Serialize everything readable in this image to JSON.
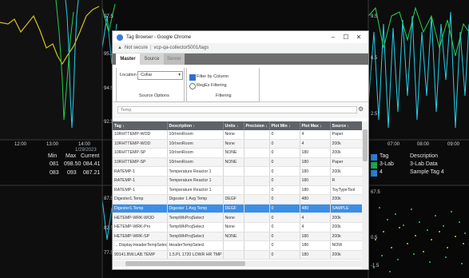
{
  "background": {
    "left_axis_times": [
      "12:00",
      "13:00",
      "14:00"
    ],
    "left_axis_dates": [
      "1/29/2023"
    ],
    "left_table": {
      "headers": [
        "Min",
        "Max",
        "Current"
      ],
      "rows": [
        {
          "min": "081",
          "max": "098.50",
          "current": "084.41"
        },
        {
          "min": "083",
          "max": "093",
          "current": "087.21"
        }
      ]
    },
    "right_axis_times": [
      "07:00",
      "08:00",
      "09:00"
    ],
    "right_table": {
      "headers": [
        "Tag",
        "Description"
      ],
      "rows": [
        {
          "tag": "3-Lab",
          "description": "3-Lab Data"
        },
        {
          "tag": "4",
          "description": "Sample Tag 4"
        }
      ]
    },
    "y_labels": [
      "97.5",
      "95.2",
      "94.5",
      "92.5",
      "90.5",
      "87.5",
      "82.5",
      "77.5",
      "72.5",
      "67.5",
      "62.5",
      "9.5",
      "6.5",
      "2.5",
      "0.5",
      "-1.5"
    ]
  },
  "window": {
    "title": "Tag Browser - Google Chrome",
    "not_secure": "Not secure",
    "url": "vcp-qa-collector5001/tags",
    "controls": {
      "minimize": "–",
      "maximize": "☐",
      "close": "✕"
    },
    "tabs": [
      {
        "label": "Master",
        "active": true
      },
      {
        "label": "Source",
        "active": false
      },
      {
        "label": "Server",
        "active": false
      }
    ],
    "source_options": {
      "location_label": "Location",
      "location_value": "Collar",
      "group_label": "Source Options"
    },
    "filtering": {
      "filter_by_column": "Filter by Column",
      "regex_filtering": "RegEx Filtering",
      "group_label": "Filtering"
    },
    "filter_text": "Temp",
    "table": {
      "headers": [
        "Tag ↓",
        "Description ↓",
        "Units ↓",
        "Precision ↓",
        "Plot Min ↓",
        "Plot Max ↓",
        "Source ↓"
      ],
      "rows": [
        [
          "10RHTTEMP-WOD",
          "10rIrenRoom",
          "None",
          "",
          "0",
          "4",
          "Paper"
        ],
        [
          "10RHTTEMP-WOD",
          "10rIrenRoom",
          "None",
          "",
          "0",
          "4",
          "200k"
        ],
        [
          "10RHTTEMP-SP",
          "10rIrenRoom",
          "NONE",
          "",
          "0",
          "180",
          "200k"
        ],
        [
          "10RHTTEMP-SP",
          "10rIrenRoom",
          "NONE",
          "",
          "0",
          "180",
          "Paper"
        ],
        [
          "RATEMP-1",
          "Temperature Reactor 1",
          "",
          "",
          "0",
          "180",
          "200k"
        ],
        [
          "RATEMP-1",
          "Temperature Reactor 1",
          "",
          "",
          "0",
          "180",
          "R"
        ],
        [
          "RATEMP-1",
          "Temperature Reactor 1",
          "",
          "",
          "0",
          "180",
          "ToyTypeTool"
        ],
        [
          "Digester1.Temp",
          "Digester 1 Avg Temp",
          "DEGF",
          "",
          "0",
          "480",
          "200k"
        ],
        [
          "Digester1.Temp",
          "Digester 1 Avg Temp",
          "DEGF",
          "",
          "0",
          "480",
          "SAMPLE"
        ],
        [
          "HETEMP-WRK-WOD",
          "TempWkProjSelect",
          "None",
          "",
          "0",
          "4",
          "200k"
        ],
        [
          "HETEMP-WRK-Pro",
          "TempWkProjSelect",
          "None",
          "",
          "0",
          "4",
          "200k"
        ],
        [
          "HETEMP-WRK-SP",
          "TempWkProjSelect",
          "NONE",
          "",
          "0",
          "180",
          "200k"
        ],
        [
          "... Display.HeaderTempSelect",
          "HeaderTempSelect",
          "",
          "",
          "0",
          "180",
          "NOW"
        ],
        [
          "99141.BW.LAB.TEMP",
          "1.5.PL 1720 LOWR HR TMP",
          "",
          "",
          "0",
          "180",
          "200k"
        ]
      ],
      "selected_row": 8
    }
  },
  "colors": {
    "selection": "#3b8ee6",
    "header": "#5f6368",
    "trend_yellow": "#d6c21a",
    "trend_cyan": "#26d0e8",
    "trend_green": "#28d04a"
  }
}
